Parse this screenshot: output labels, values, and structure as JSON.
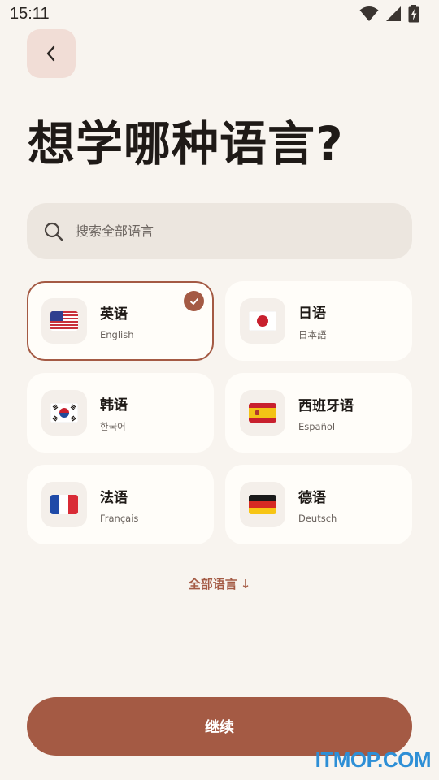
{
  "status_bar": {
    "time": "15:11"
  },
  "title": "想学哪种语言?",
  "search": {
    "placeholder": "搜索全部语言"
  },
  "languages": [
    {
      "name": "英语",
      "native": "English",
      "flag": "us-flag",
      "selected": true
    },
    {
      "name": "日语",
      "native": "日本語",
      "flag": "jp-flag",
      "selected": false
    },
    {
      "name": "韩语",
      "native": "한국어",
      "flag": "kr-flag",
      "selected": false
    },
    {
      "name": "西班牙语",
      "native": "Español",
      "flag": "es-flag",
      "selected": false
    },
    {
      "name": "法语",
      "native": "Français",
      "flag": "fr-flag",
      "selected": false
    },
    {
      "name": "德语",
      "native": "Deutsch",
      "flag": "de-flag",
      "selected": false
    }
  ],
  "all_languages_label": "全部语言",
  "all_languages_arrow": "↓",
  "continue_label": "继续",
  "watermark": "ITMOP.COM",
  "colors": {
    "accent": "#a45a44",
    "background": "#f8f4ef",
    "card": "#fffdf9"
  }
}
